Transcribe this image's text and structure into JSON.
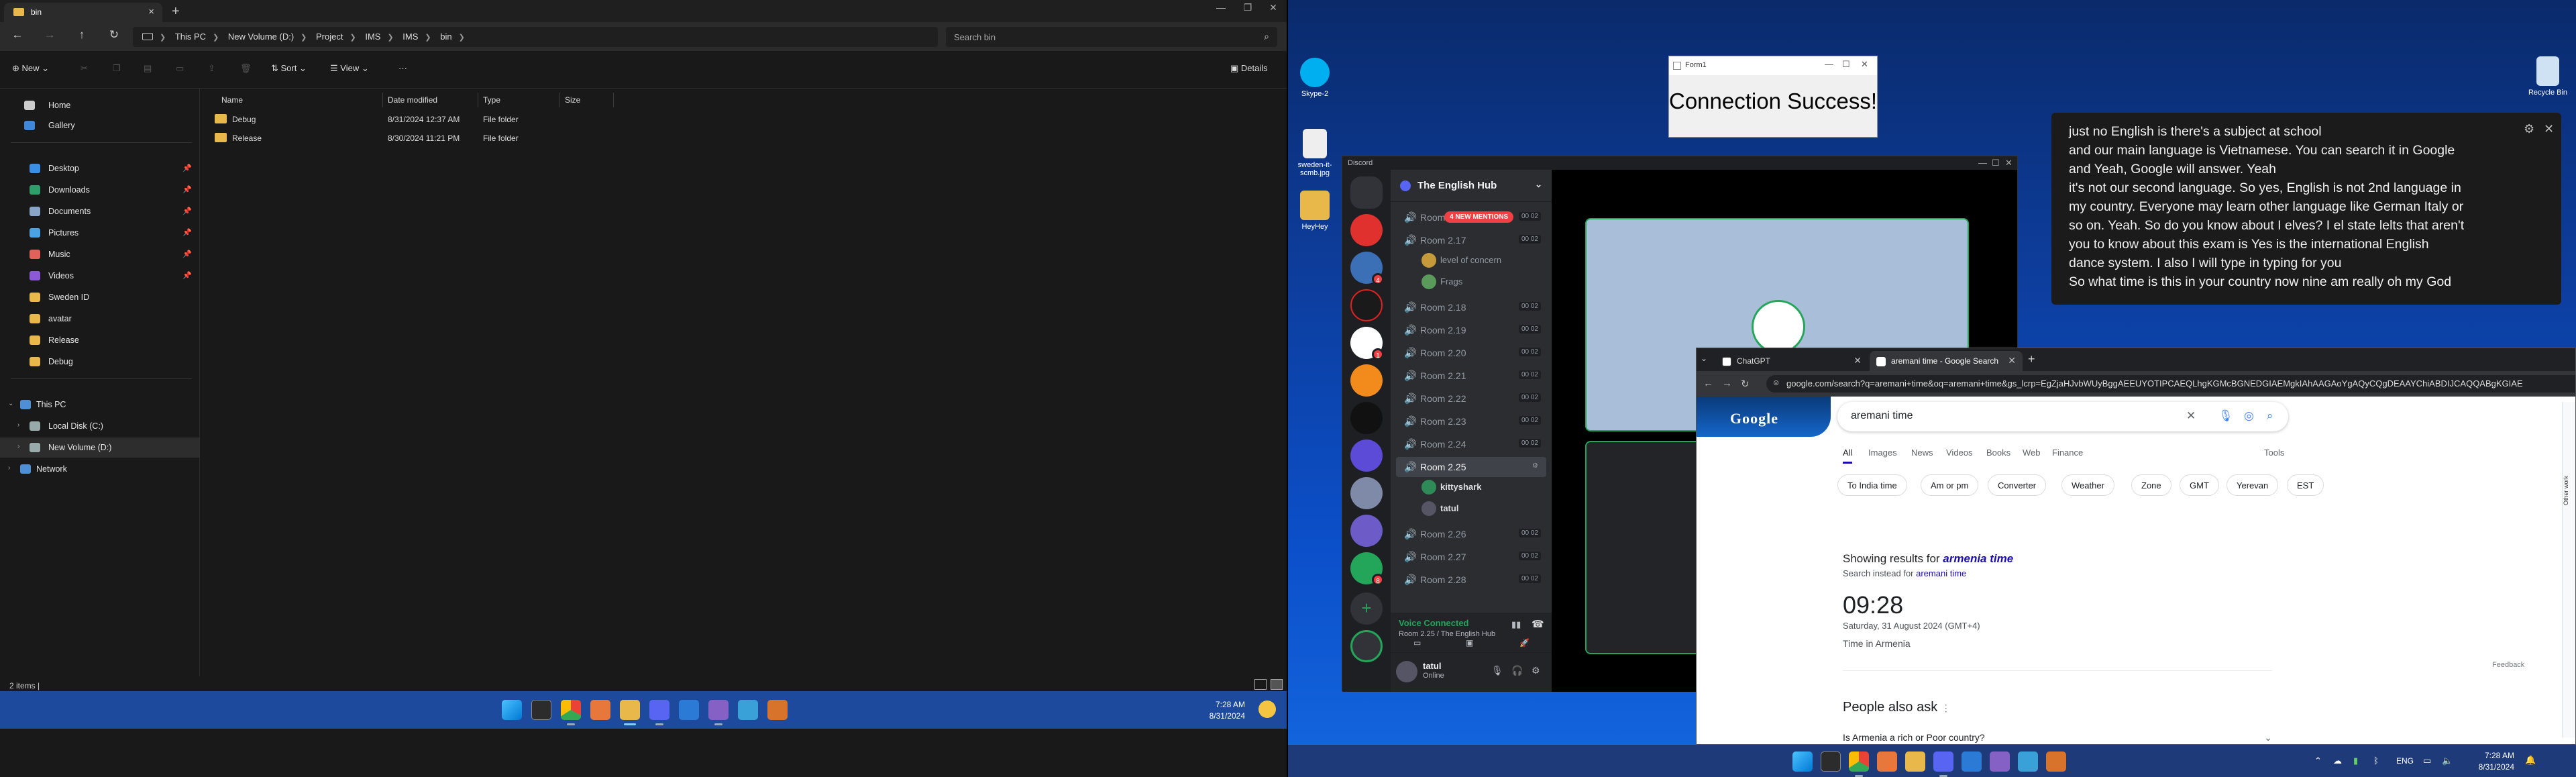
{
  "explorer": {
    "tab_title": "bin",
    "address": [
      "This PC",
      "New Volume (D:)",
      "Project",
      "IMS",
      "IMS",
      "bin"
    ],
    "search_placeholder": "Search bin",
    "cmd": {
      "new": "New",
      "sort": "Sort",
      "view": "View",
      "more": "···",
      "details": "Details"
    },
    "nav": {
      "home": "Home",
      "gallery": "Gallery",
      "desktop": "Desktop",
      "downloads": "Downloads",
      "documents": "Documents",
      "pictures": "Pictures",
      "music": "Music",
      "videos": "Videos",
      "sweden": "Sweden ID",
      "avatar": "avatar",
      "release": "Release",
      "debug": "Debug",
      "thispc": "This PC",
      "localc": "Local Disk (C:)",
      "volumed": "New Volume (D:)",
      "network": "Network"
    },
    "columns": {
      "name": "Name",
      "date": "Date modified",
      "type": "Type",
      "size": "Size"
    },
    "files": [
      {
        "name": "Debug",
        "date": "8/31/2024 12:37 AM",
        "type": "File folder"
      },
      {
        "name": "Release",
        "date": "8/30/2024 11:21 PM",
        "type": "File folder"
      }
    ],
    "status": "2 items  |"
  },
  "taskbar1": {
    "time": "7:28 AM",
    "date": "8/31/2024"
  },
  "taskbar2": {
    "time": "7:28 AM",
    "date": "8/31/2024",
    "lang": "ENG"
  },
  "desktop2": {
    "icons": {
      "skype": "Skype-2",
      "sweden": "sweden-it-scmb.jpg",
      "heyhey": "HeyHey",
      "recycle": "Recycle Bin"
    }
  },
  "form1": {
    "title": "Form1",
    "message": "Connection Success!"
  },
  "caption": {
    "lines": [
      "just no English is there's a subject at school",
      "and our main language is Vietnamese. You can search it in Google",
      "and Yeah, Google will answer. Yeah",
      "it's not our second language. So yes, English is not 2nd language in",
      "my country. Everyone may learn other language like German Italy or",
      "so on. Yeah. So do you know about I elves? I el state lelts that aren't",
      "you to know about this exam is Yes is the international English",
      "dance system. I also I will type in typing for you",
      "So what time is this in your country now nine am really oh my God"
    ]
  },
  "discord": {
    "app_title": "Discord",
    "guild": "The English Hub",
    "mention_badge": "4 NEW MENTIONS",
    "rooms": [
      {
        "name": "Room 2.16",
        "count": "00 02"
      },
      {
        "name": "Room 2.17",
        "count": "00 02"
      },
      {
        "name": "Room 2.18",
        "count": "00 02"
      },
      {
        "name": "Room 2.19",
        "count": "00 02"
      },
      {
        "name": "Room 2.20",
        "count": "00 02"
      },
      {
        "name": "Room 2.21",
        "count": "00 02"
      },
      {
        "name": "Room 2.22",
        "count": "00 02"
      },
      {
        "name": "Room 2.23",
        "count": "00 02"
      },
      {
        "name": "Room 2.24",
        "count": "00 02"
      },
      {
        "name": "Room 2.25",
        "count": ""
      },
      {
        "name": "Room 2.26",
        "count": "00 02"
      },
      {
        "name": "Room 2.27",
        "count": "00 02"
      },
      {
        "name": "Room 2.28",
        "count": "00 02"
      }
    ],
    "room17_users": [
      "level of concern",
      "Frags"
    ],
    "room25_users": [
      "kittyshark",
      "tatul"
    ],
    "voice_status": "Voice Connected",
    "voice_location": "Room 2.25 / The English Hub",
    "user": {
      "name": "tatul",
      "status": "Online"
    }
  },
  "chrome": {
    "tabs": [
      "ChatGPT",
      "aremani time - Google Search"
    ],
    "url": "google.com/search?q=aremani+time&oq=aremani+time&gs_lcrp=EgZjaHJvbWUyBggAEEUYOTIPCAEQLhgKGMcBGNEDGIAEMgkIAhAAGAoYgAQyCQgDEAAYChiABDIJCAQQABgKGIAE",
    "query": "aremani time",
    "nav": [
      "All",
      "Images",
      "News",
      "Videos",
      "Books",
      "Web",
      "Finance"
    ],
    "tools": "Tools",
    "chips": [
      "To India time",
      "Am or pm",
      "Converter",
      "Weather",
      "Zone",
      "GMT",
      "Yerevan",
      "EST"
    ],
    "showing_prefix": "Showing results for ",
    "showing_term": "armenia time",
    "instead_prefix": "Search instead for ",
    "instead_term": "aremani time",
    "time": "09:28",
    "date_line": "Saturday, 31 August 2024 (GMT+4)",
    "place": "Time in Armenia",
    "feedback": "Feedback",
    "paa_title": "People also ask",
    "paa_q1": "Is Armenia a rich or Poor country?",
    "side_text": "Other work"
  }
}
